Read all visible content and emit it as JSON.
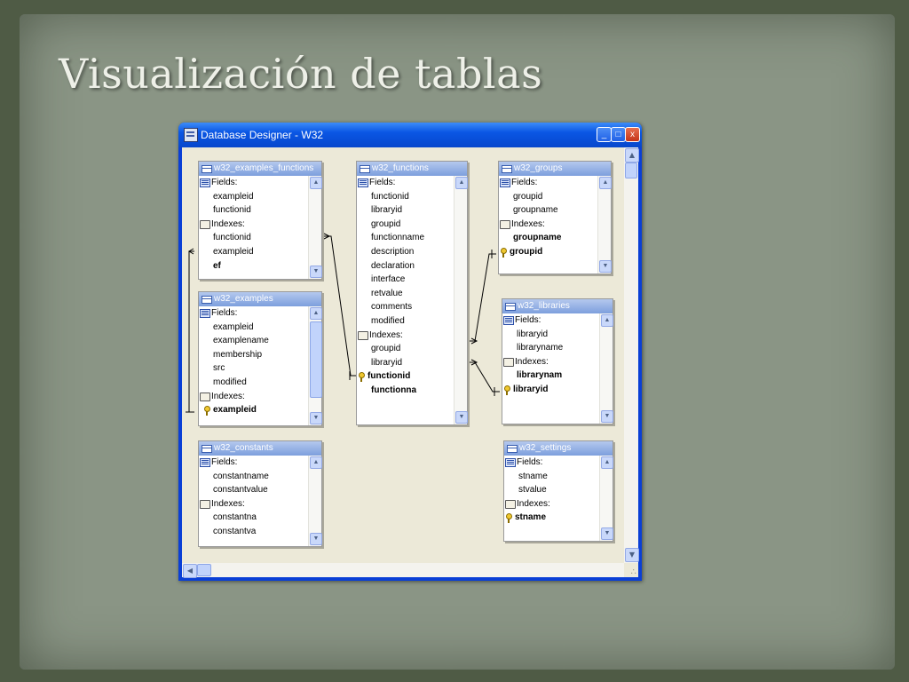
{
  "slide": {
    "title": "Visualización de tablas"
  },
  "window": {
    "title": "Database Designer - W32",
    "minimize": "_",
    "maximize": "□",
    "close": "x"
  },
  "scroll": {
    "up": "▲",
    "down": "▼",
    "left": "◀",
    "right": "▶",
    "grip": "∴"
  },
  "tables": {
    "examples_functions": {
      "name": "w32_examples_functions",
      "fields_label": "Fields:",
      "fields": [
        "exampleid",
        "functionid"
      ],
      "indexes_label": "Indexes:",
      "indexes": [
        "functionid",
        "exampleid"
      ],
      "key_index": "ef"
    },
    "functions": {
      "name": "w32_functions",
      "fields_label": "Fields:",
      "fields": [
        "functionid",
        "libraryid",
        "groupid",
        "functionname",
        "description",
        "declaration",
        "interface",
        "retvalue",
        "comments",
        "modified"
      ],
      "indexes_label": "Indexes:",
      "indexes": [
        "groupid",
        "libraryid"
      ],
      "key_index": "functionid",
      "bold_index": "functionna"
    },
    "groups": {
      "name": "w32_groups",
      "fields_label": "Fields:",
      "fields": [
        "groupid",
        "groupname"
      ],
      "indexes_label": "Indexes:",
      "bold_index": "groupname",
      "key_index": "groupid"
    },
    "examples": {
      "name": "w32_examples",
      "fields_label": "Fields:",
      "fields": [
        "exampleid",
        "examplename",
        "membership",
        "src",
        "modified"
      ],
      "indexes_label": "Indexes:",
      "key_index": "exampleid"
    },
    "libraries": {
      "name": "w32_libraries",
      "fields_label": "Fields:",
      "fields": [
        "libraryid",
        "libraryname"
      ],
      "indexes_label": "Indexes:",
      "bold_index": "librarynam",
      "key_index": "libraryid"
    },
    "constants": {
      "name": "w32_constants",
      "fields_label": "Fields:",
      "fields": [
        "constantname",
        "constantvalue"
      ],
      "indexes_label": "Indexes:",
      "indexes": [
        "constantna",
        "constantva"
      ]
    },
    "settings": {
      "name": "w32_settings",
      "fields_label": "Fields:",
      "fields": [
        "stname",
        "stvalue"
      ],
      "indexes_label": "Indexes:",
      "key_index": "stname"
    }
  },
  "colors": {
    "titlebar": "#0a56e4",
    "table_header": "#7d9fdd",
    "canvas": "#ece9d8",
    "slide_bg": "#8a9585"
  }
}
